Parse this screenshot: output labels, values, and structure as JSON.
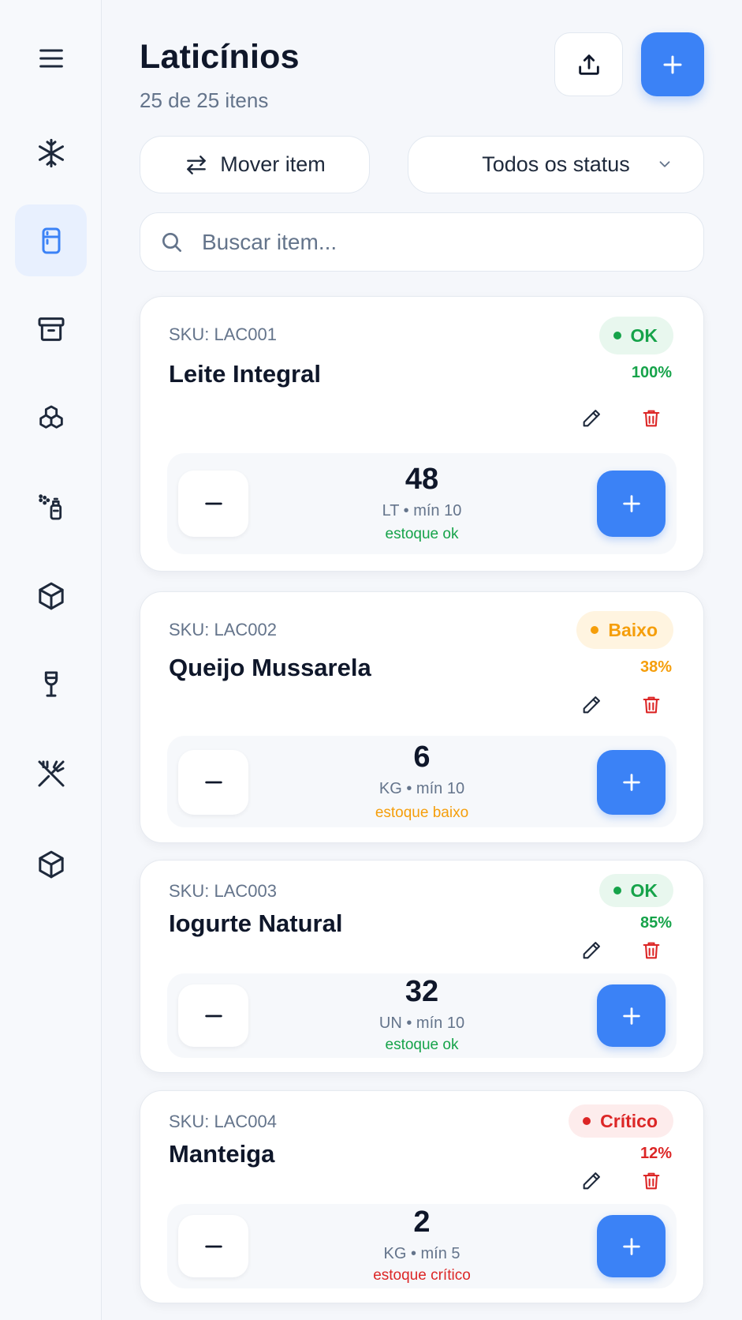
{
  "header": {
    "title": "Laticínios",
    "subtitle": "25 de 25 itens"
  },
  "toolbar": {
    "move_label": "Mover item",
    "status_filter": "Todos os status"
  },
  "search": {
    "placeholder": "Buscar item..."
  },
  "sidebar": {
    "items": [
      {
        "icon": "menu-icon"
      },
      {
        "icon": "snowflake-icon"
      },
      {
        "icon": "fridge-icon",
        "active": true
      },
      {
        "icon": "archive-box-icon"
      },
      {
        "icon": "boxes-icon"
      },
      {
        "icon": "spray-bottle-icon"
      },
      {
        "icon": "package-icon"
      },
      {
        "icon": "wine-glass-icon"
      },
      {
        "icon": "utensils-crossed-icon"
      },
      {
        "icon": "package-icon"
      }
    ]
  },
  "colors": {
    "accent": "#3b82f6",
    "ok": "#16a34a",
    "ok_bg": "#e8f7ee",
    "low": "#f59e0b",
    "low_bg": "#fff4e0",
    "critical": "#dc2626",
    "critical_bg": "#fdecec"
  },
  "items": [
    {
      "sku": "SKU: LAC001",
      "name": "Leite Integral",
      "status": "OK",
      "percent": "100%",
      "qty": "48",
      "unit_line": "LT • mín 10",
      "stock_text": "estoque ok",
      "status_type": "ok"
    },
    {
      "sku": "SKU: LAC002",
      "name": "Queijo Mussarela",
      "status": "Baixo",
      "percent": "38%",
      "qty": "6",
      "unit_line": "KG • mín 10",
      "stock_text": "estoque baixo",
      "status_type": "low"
    },
    {
      "sku": "SKU: LAC003",
      "name": "Iogurte Natural",
      "status": "OK",
      "percent": "85%",
      "qty": "32",
      "unit_line": "UN • mín 10",
      "stock_text": "estoque ok",
      "status_type": "ok"
    },
    {
      "sku": "SKU: LAC004",
      "name": "Manteiga",
      "status": "Crítico",
      "percent": "12%",
      "qty": "2",
      "unit_line": "KG • mín 5",
      "stock_text": "estoque crítico",
      "status_type": "critical"
    }
  ]
}
